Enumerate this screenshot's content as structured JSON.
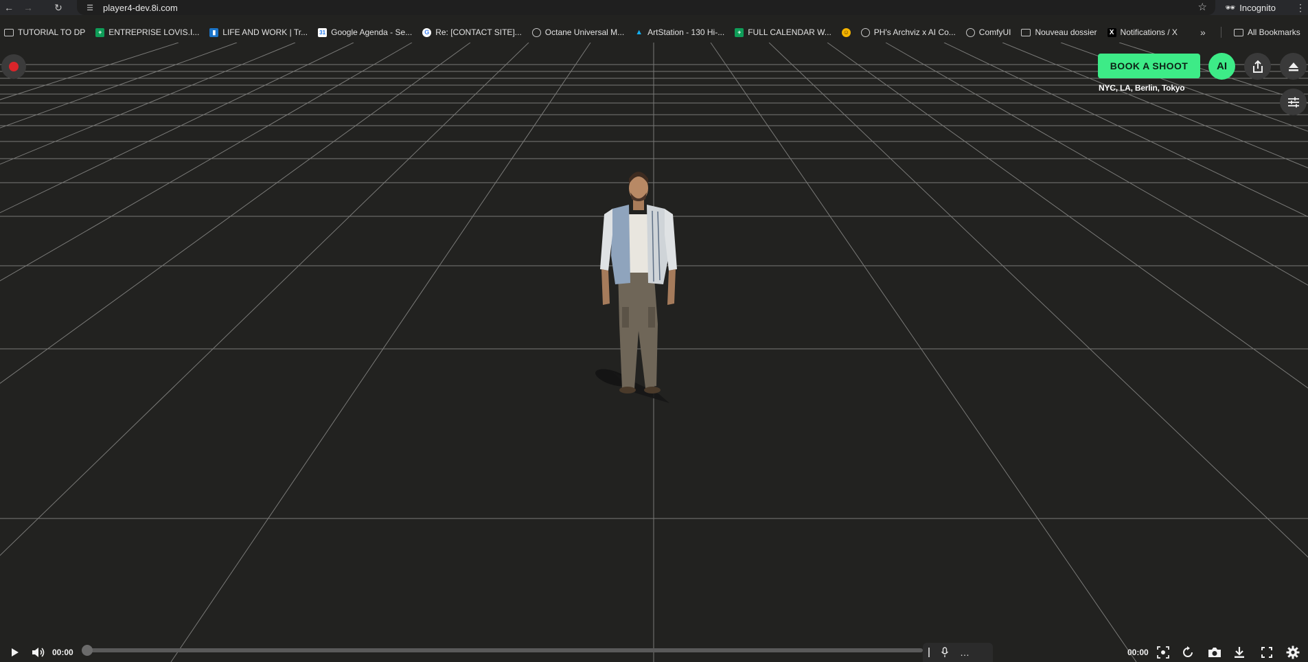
{
  "browser": {
    "url": "player4-dev.8i.com",
    "profile_label": "Incognito"
  },
  "bookmarks": [
    {
      "label": "TUTORIAL TO DP",
      "icon": "folder-icon"
    },
    {
      "label": "ENTREPRISE LOVIS.I...",
      "icon": "sheets-icon"
    },
    {
      "label": "LIFE AND WORK | Tr...",
      "icon": "trello-icon"
    },
    {
      "label": "Google Agenda - Se...",
      "icon": "calendar-icon"
    },
    {
      "label": "Re: [CONTACT SITE]...",
      "icon": "google-icon"
    },
    {
      "label": "Octane Universal M...",
      "icon": "globe-icon"
    },
    {
      "label": "ArtStation - 130 Hi-...",
      "icon": "artstation-icon"
    },
    {
      "label": "FULL CALENDAR W...",
      "icon": "sheets-icon"
    },
    {
      "label": "",
      "icon": "hugging-face-icon"
    },
    {
      "label": "PH's Archviz x AI Co...",
      "icon": "globe-icon"
    },
    {
      "label": "ComfyUI",
      "icon": "globe-icon"
    },
    {
      "label": "Nouveau dossier",
      "icon": "folder-icon"
    },
    {
      "label": "Notifications / X",
      "icon": "x-icon"
    }
  ],
  "all_bookmarks_label": "All Bookmarks",
  "player": {
    "book_button": "BOOK A SHOOT",
    "cities": "NYC, LA, Berlin, Tokyo",
    "ai_button": "AI",
    "current_time": "00:00",
    "duration": "00:00",
    "progress": 0
  },
  "colors": {
    "accent_green": "#3deb87",
    "record_red": "#d9252a",
    "background": "#222220"
  }
}
